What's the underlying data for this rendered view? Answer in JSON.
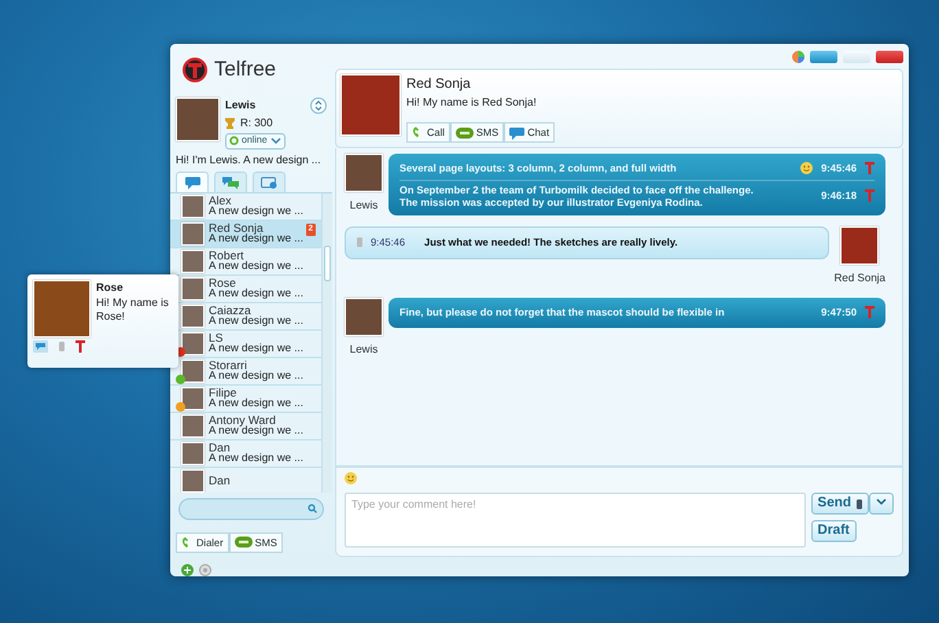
{
  "app": {
    "title": "Telfree"
  },
  "profile": {
    "name": "Lewis",
    "rating": "R: 300",
    "status": "online",
    "status_text": "Hi! I'm Lewis. A new design ..."
  },
  "tabs": [
    {
      "kind": "chat",
      "selected": true
    },
    {
      "kind": "group",
      "selected": false
    },
    {
      "kind": "contacts",
      "selected": false
    }
  ],
  "contacts": [
    {
      "name": "Alex",
      "message": "A new design we ...",
      "selected": false
    },
    {
      "name": "Red Sonja",
      "message": "A new design we ...",
      "selected": true,
      "unread": "2"
    },
    {
      "name": "Robert",
      "message": "A new design we ...",
      "selected": false
    },
    {
      "name": "Rose",
      "message": "A new design we ...",
      "selected": false
    },
    {
      "name": "Caiazza",
      "message": "A new design we ...",
      "selected": false
    },
    {
      "name": "LS",
      "message": "A new design we ...",
      "selected": false,
      "color": "#e03020"
    },
    {
      "name": "Storarri",
      "message": "A new design we ...",
      "selected": false,
      "color": "#5cb82a"
    },
    {
      "name": "Filipe",
      "message": "A new design we ...",
      "selected": false,
      "color": "#f0a020"
    },
    {
      "name": "Antony Ward",
      "message": "A new design we ...",
      "selected": false
    },
    {
      "name": "Dan",
      "message": "A new design we ...",
      "selected": false
    },
    {
      "name": "Dan",
      "selected": false
    }
  ],
  "bottom_buttons": [
    {
      "kind": "dialer",
      "label": "Dialer"
    },
    {
      "kind": "sms",
      "label": "SMS"
    }
  ],
  "chat": {
    "name": "Red Sonja",
    "status_text": "Hi! My name is Red Sonja!",
    "actions": [
      {
        "kind": "call",
        "label": "Call"
      },
      {
        "kind": "sms",
        "label": "SMS"
      },
      {
        "kind": "chat",
        "label": "Chat"
      }
    ]
  },
  "messages": [
    {
      "kind": "outgoing",
      "author": "Lewis",
      "lines": [
        {
          "text": "Several page layouts: 3 column, 2 column, and full width",
          "smiley": true,
          "time": "9:45:46"
        },
        {
          "text": "On September 2 the team of Turbomilk decided to face off the challenge.\nThe mission was accepted by our illustrator Evgeniya Rodina.",
          "time": "9:46:18"
        }
      ]
    },
    {
      "kind": "incoming",
      "author": "Red Sonja",
      "lines": [
        {
          "text": "Just what we needed! The sketches are really lively.",
          "time": "9:45:46"
        }
      ]
    },
    {
      "kind": "outgoing",
      "author": "Lewis",
      "lines": [
        {
          "text": "Fine, but please do not forget that the mascot should be flexible in",
          "time": "9:47:50"
        }
      ]
    }
  ],
  "composer": {
    "placeholder": "Type your comment here!",
    "send": "Send",
    "draft": "Draft"
  },
  "popup": {
    "name": "Rose",
    "status_text": "Hi! My name is Rose!"
  }
}
